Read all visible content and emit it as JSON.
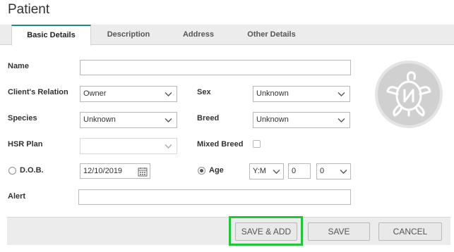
{
  "window": {
    "title": "Patient"
  },
  "tabs": [
    {
      "label": "Basic Details",
      "active": true
    },
    {
      "label": "Description",
      "active": false
    },
    {
      "label": "Address",
      "active": false
    },
    {
      "label": "Other Details",
      "active": false
    }
  ],
  "form": {
    "name": {
      "label": "Name",
      "value": ""
    },
    "clients_relation": {
      "label": "Client's Relation",
      "value": "Owner"
    },
    "sex": {
      "label": "Sex",
      "value": "Unknown"
    },
    "species": {
      "label": "Species",
      "value": "Unknown"
    },
    "breed": {
      "label": "Breed",
      "value": "Unknown"
    },
    "hsr_plan": {
      "label": "HSR Plan",
      "value": ""
    },
    "mixed_breed": {
      "label": "Mixed Breed",
      "checked": false
    },
    "dob": {
      "label": "D.O.B.",
      "value": "12/10/2019",
      "selected": false
    },
    "age": {
      "label": "Age",
      "selected": true,
      "unit": "Y:M",
      "years": "0",
      "months": "0"
    },
    "alert": {
      "label": "Alert",
      "value": ""
    }
  },
  "buttons": {
    "save_add": "SAVE & ADD",
    "save": "SAVE",
    "cancel": "CANCEL"
  },
  "colors": {
    "accent_tab": "#1f8a7e",
    "highlight": "#22c43a",
    "avatar_bg": "#d0d0d0"
  },
  "icons": {
    "avatar": "turtle-logo-icon",
    "calendar": "calendar-icon",
    "dropdown": "chevron-down-icon"
  }
}
